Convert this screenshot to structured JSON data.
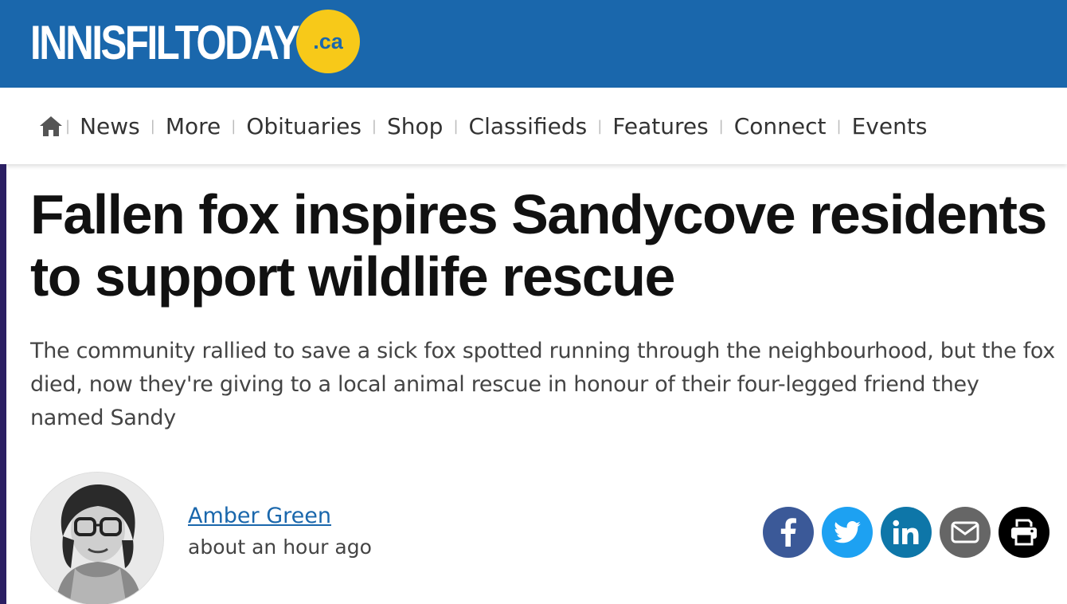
{
  "site": {
    "logo_text": "INNISFILTODAY",
    "logo_suffix": ".ca",
    "brand_color": "#1a67ac",
    "accent_color": "#f7c919"
  },
  "nav": {
    "home_icon": "home-icon",
    "items": [
      "News",
      "More",
      "Obituaries",
      "Shop",
      "Classifieds",
      "Features",
      "Connect",
      "Events"
    ],
    "separator": "|"
  },
  "article": {
    "headline": "Fallen fox inspires Sandycove residents to support wildlife rescue",
    "dek": "The community rallied to save a sick fox spotted running through the neighbourhood, but the fox died, now they're giving to a local animal rescue in honour of their four-legged friend they named Sandy",
    "author": "Amber Green",
    "timestamp": "about an hour ago"
  },
  "share": {
    "buttons": [
      {
        "name": "facebook",
        "icon": "facebook-icon",
        "color": "#3b5998"
      },
      {
        "name": "twitter",
        "icon": "twitter-icon",
        "color": "#1da1f2"
      },
      {
        "name": "linkedin",
        "icon": "linkedin-icon",
        "color": "#0e76a8"
      },
      {
        "name": "email",
        "icon": "email-icon",
        "color": "#666666"
      },
      {
        "name": "print",
        "icon": "print-icon",
        "color": "#000000"
      }
    ]
  }
}
